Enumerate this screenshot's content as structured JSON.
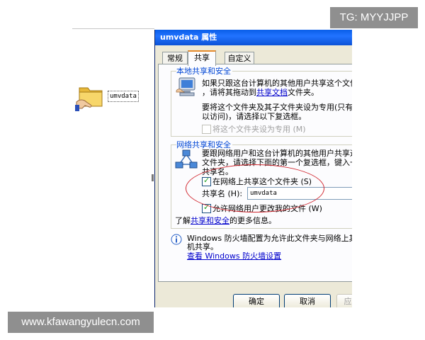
{
  "watermarks": {
    "top_right": "TG: MYYJJPP",
    "bottom_left": "www.kfawangyulecn.com"
  },
  "desktop": {
    "folder_name": "umvdata",
    "folder_icon": "folder-share-icon"
  },
  "dialog": {
    "title": "umvdata 属性",
    "tabs": [
      {
        "label": "常规",
        "active": false
      },
      {
        "label": "共享",
        "active": true
      },
      {
        "label": "自定义",
        "active": false
      }
    ],
    "local": {
      "title": "本地共享和安全",
      "text_line1": "如果只跟这台计算机的其他用户共享这个文件",
      "text_line2_a": "，请将其拖动到",
      "text_line2_link": "共享文档",
      "text_line2_b": "文件夹。",
      "text_line3": "要将这个文件夹及其子文件夹设为专用(只有您",
      "text_line4": "以访问)，请选择以下复选框。",
      "checkbox_label": "将这个文件夹设为专用",
      "checkbox_hotkey": "(M)",
      "checkbox_checked": false
    },
    "network": {
      "title": "网络共享和安全",
      "text_line1": "要跟网络用户和这台计算机的其他用户共享这",
      "text_line2": "文件夹，请选择下面的第一个复选框，键入一",
      "text_line3": "共享名。",
      "share_checkbox_label": "在网络上共享这个文件夹",
      "share_checkbox_hotkey": "(S)",
      "share_checked": true,
      "share_name_label": "共享名",
      "share_name_hotkey": "(H):",
      "share_name_value": "umvdata",
      "allow_checkbox_label": "允许网络用户更改我的文件",
      "allow_checkbox_hotkey": "(W)",
      "allow_checked": true,
      "more_info_a": "了解",
      "more_info_link": "共享和安全",
      "more_info_b": "的更多信息。"
    },
    "firewall": {
      "text_line1": "Windows 防火墙配置为允许此文件夹与网络上其他",
      "text_line2": "机共享。",
      "link": "查看 Windows 防火墙设置",
      "icon": "info-icon"
    },
    "buttons": {
      "ok": "确定",
      "cancel": "取消",
      "apply": "应"
    }
  }
}
